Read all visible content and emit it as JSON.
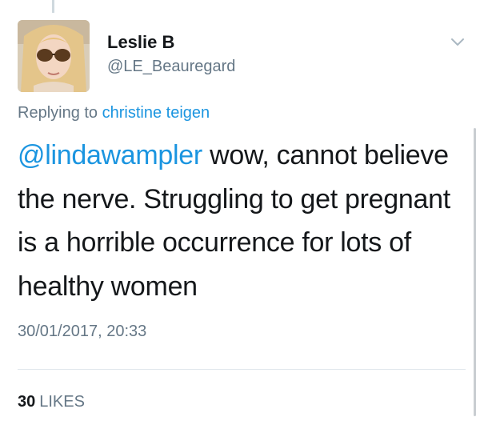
{
  "tweet": {
    "author": {
      "display_name": "Leslie B",
      "handle": "@LE_Beauregard",
      "avatar_icon": "profile-photo"
    },
    "replying_to": {
      "prefix": "Replying to",
      "name": "christine teigen"
    },
    "text": {
      "mention": "@lindawampler",
      "body": " wow, cannot believe the nerve.  Struggling to get pregnant is a horrible occurrence for lots of healthy women"
    },
    "timestamp": "30/01/2017, 20:33",
    "likes": {
      "count": "30",
      "label": "LIKES"
    },
    "menu_icon": "chevron-down-icon"
  },
  "colors": {
    "link": "#1b95e0",
    "secondary_text": "#657786",
    "primary_text": "#14171a",
    "divider": "#e1e8ed"
  }
}
